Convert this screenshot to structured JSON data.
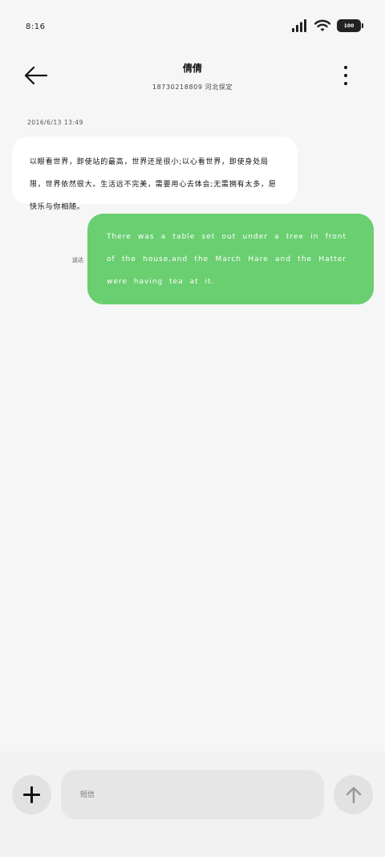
{
  "status_bar": {
    "time": "8:16",
    "battery": "100",
    "signal_icon": "cellular-signal-icon",
    "wifi_icon": "wifi-icon"
  },
  "header": {
    "back_icon": "arrow-left-icon",
    "contact_name": "倩倩",
    "contact_subtitle": "18730218809  河北保定",
    "more_icon": "more-vertical-icon"
  },
  "conversation": {
    "timestamp": "2016/6/13  13:49",
    "messages": [
      {
        "direction": "incoming",
        "text": "以眼看世界，即使站的最高，世界还是很小;以心看世界，即使身处局限，世界依然很大。生活远不完美，需要用心去体会;无需拥有太多，愿快乐与你相随。"
      },
      {
        "direction": "outgoing",
        "text": "There was a table set out under a tree in front of the house,and the March Hare and the Hatter were having tea at it.",
        "status": "送达"
      }
    ]
  },
  "compose": {
    "add_icon": "plus-icon",
    "placeholder": "短信",
    "value": "",
    "send_icon": "arrow-up-icon"
  },
  "colors": {
    "background": "#f6f6f6",
    "incoming_bubble": "#ffffff",
    "outgoing_bubble": "#6acf71",
    "button_bg": "#e2e2e2"
  }
}
